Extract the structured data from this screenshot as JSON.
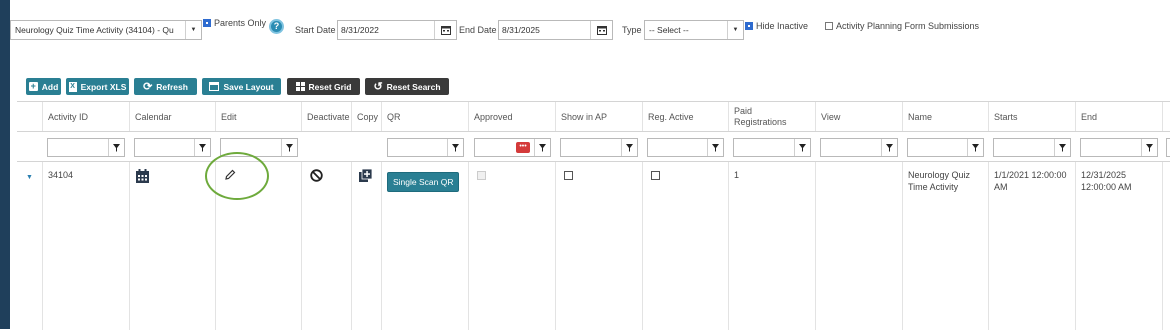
{
  "filters": {
    "activity_select": "Neurology Quiz Time Activity (34104) - Qu",
    "parents_only_label": "Parents Only",
    "parents_only_checked": true,
    "start_date_label": "Start Date",
    "start_date": "8/31/2022",
    "end_date_label": "End Date",
    "end_date": "8/31/2025",
    "type_label": "Type",
    "type_value": "-- Select --",
    "hide_inactive_label": "Hide Inactive",
    "hide_inactive_checked": true,
    "planning_form_label": "Activity Planning Form Submissions",
    "planning_form_checked": false
  },
  "toolbar": {
    "add": "Add",
    "export": "Export XLS",
    "refresh": "Refresh",
    "save_layout": "Save Layout",
    "reset_grid": "Reset Grid",
    "reset_search": "Reset Search"
  },
  "columns": [
    "Activity ID",
    "Calendar",
    "Edit",
    "Deactivate",
    "Copy",
    "QR",
    "Approved",
    "Show in AP",
    "Reg. Active",
    "Paid Registrations",
    "View",
    "Name",
    "Starts",
    "End"
  ],
  "row": {
    "activity_id": "34104",
    "qr_button": "Single Scan QR",
    "paid_registrations": "1",
    "name": "Neurology Quiz Time Activity",
    "starts": "1/1/2021 12:00:00 AM",
    "end": "12/31/2025 12:00:00 AM",
    "approved_checked": false,
    "show_in_ap_checked": false,
    "reg_active_checked": false
  },
  "colors": {
    "teal_button": "#2a7f93",
    "dark_button": "#3a3a3a",
    "highlight": "#6eaa3c",
    "left_sidebar": "#1f3f5b"
  }
}
